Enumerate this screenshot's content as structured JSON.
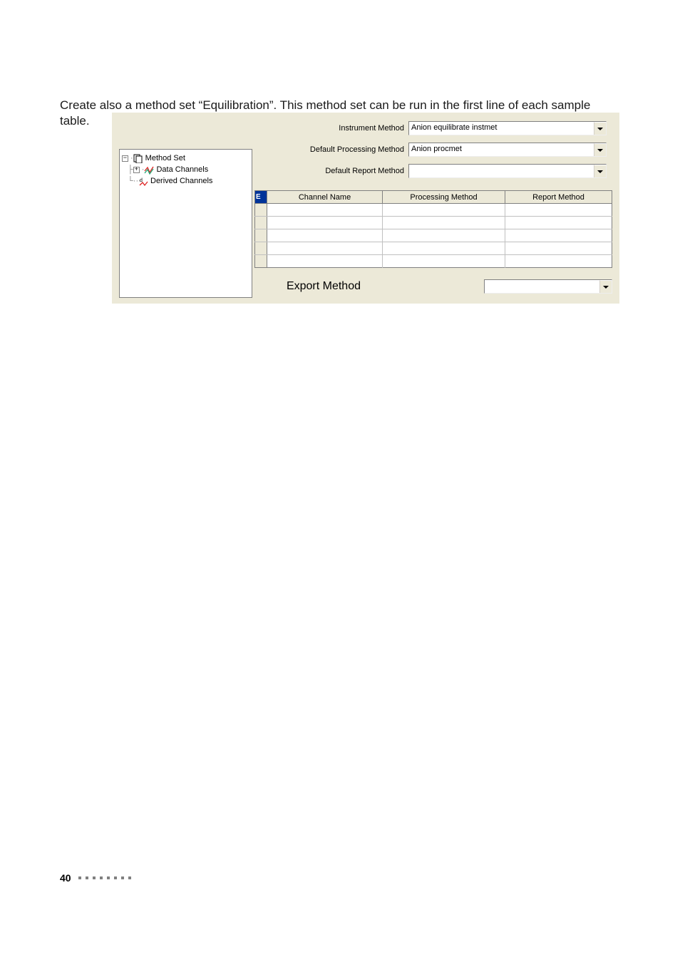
{
  "introText": "Create also a method set “Equilibration”. This method set can be run in the first line of each sample table.",
  "tree": {
    "root": {
      "label": "Method Set"
    },
    "child1": {
      "label": "Data Channels"
    },
    "child2": {
      "label": "Derived Channels"
    }
  },
  "form": {
    "instrumentMethod": {
      "label": "Instrument Method",
      "value": "Anion equilibrate instmet"
    },
    "defaultProcessingMethod": {
      "label": "Default Processing Method",
      "value": "Anion procmet"
    },
    "defaultReportMethod": {
      "label": "Default Report Method",
      "value": ""
    },
    "exportMethod": {
      "label": "Export Method",
      "value": ""
    }
  },
  "grid": {
    "cornerLetter": "E",
    "headers": {
      "channel": "Channel Name",
      "processing": "Processing Method",
      "report": "Report Method"
    },
    "rows": [
      {
        "channel": "",
        "processing": "",
        "report": ""
      },
      {
        "channel": "",
        "processing": "",
        "report": ""
      },
      {
        "channel": "",
        "processing": "",
        "report": ""
      },
      {
        "channel": "",
        "processing": "",
        "report": ""
      },
      {
        "channel": "",
        "processing": "",
        "report": ""
      }
    ]
  },
  "footer": {
    "pageNumber": "40"
  }
}
